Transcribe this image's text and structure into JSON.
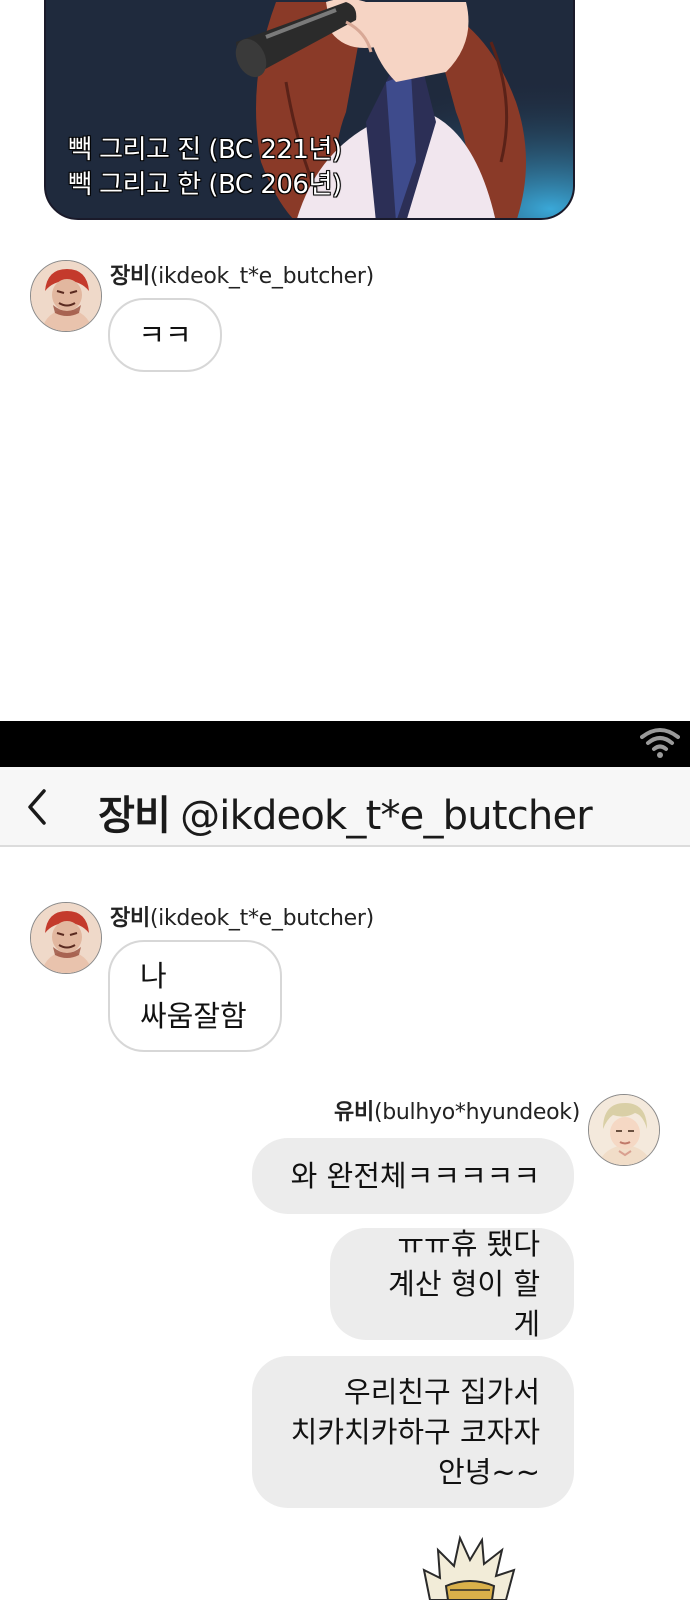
{
  "top_panel": {
    "caption_lines": [
      "빽 그리고 진 (BC 221년)",
      "빽 그리고 한 (BC 206년)"
    ]
  },
  "first_thread": {
    "message": {
      "sender_name": "장비",
      "sender_handle": "(ikdeok_t*e_butcher)",
      "text": "ㅋㅋ"
    }
  },
  "status_bar": {
    "icon": "wifi-icon"
  },
  "header": {
    "back_icon": "chevron-left-icon",
    "name": "장비",
    "handle": "@ikdeok_t*e_butcher"
  },
  "conversation": {
    "jangbi": {
      "sender_name": "장비",
      "sender_handle": "(ikdeok_t*e_butcher)",
      "lines": [
        "나",
        "싸움잘함"
      ]
    },
    "yubi": {
      "sender_name": "유비",
      "sender_handle": "(bulhyo*hyundeok)",
      "messages": [
        {
          "lines": [
            "와 완전체ㅋㅋㅋㅋㅋ"
          ]
        },
        {
          "lines": [
            "ㅠㅠ휴 됐다",
            "계산 형이 할게"
          ]
        },
        {
          "lines": [
            "우리친구 집가서",
            "치카치카하구 코자자",
            "안녕~~"
          ]
        }
      ]
    }
  },
  "colors": {
    "status_bar": "#000000",
    "nav_bg": "#f7f7f7",
    "incoming_bubble": "#ffffff",
    "outgoing_bubble": "#ececec"
  }
}
